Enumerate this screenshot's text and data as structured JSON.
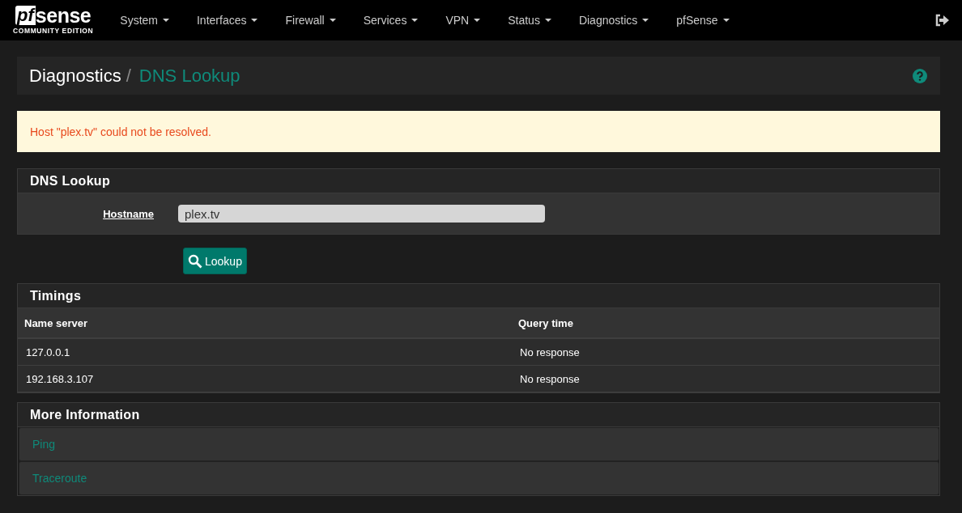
{
  "brand": {
    "name": "sense",
    "mark": "pf",
    "edition": "COMMUNITY EDITION"
  },
  "nav": [
    {
      "label": "System"
    },
    {
      "label": "Interfaces"
    },
    {
      "label": "Firewall"
    },
    {
      "label": "Services"
    },
    {
      "label": "VPN"
    },
    {
      "label": "Status"
    },
    {
      "label": "Diagnostics"
    },
    {
      "label": "pfSense"
    }
  ],
  "breadcrumb": {
    "parent": "Diagnostics",
    "separator": "/",
    "current": "DNS Lookup"
  },
  "alert": {
    "text": "Host \"plex.tv\" could not be resolved."
  },
  "lookup_panel": {
    "title": "DNS Lookup",
    "field_label": "Hostname",
    "value": "plex.tv",
    "button": "Lookup"
  },
  "timings": {
    "title": "Timings",
    "columns": [
      "Name server",
      "Query time"
    ],
    "rows": [
      [
        "127.0.0.1",
        "No response"
      ],
      [
        "192.168.3.107",
        "No response"
      ]
    ]
  },
  "more_info": {
    "title": "More Information",
    "links": [
      "Ping",
      "Traceroute"
    ]
  }
}
